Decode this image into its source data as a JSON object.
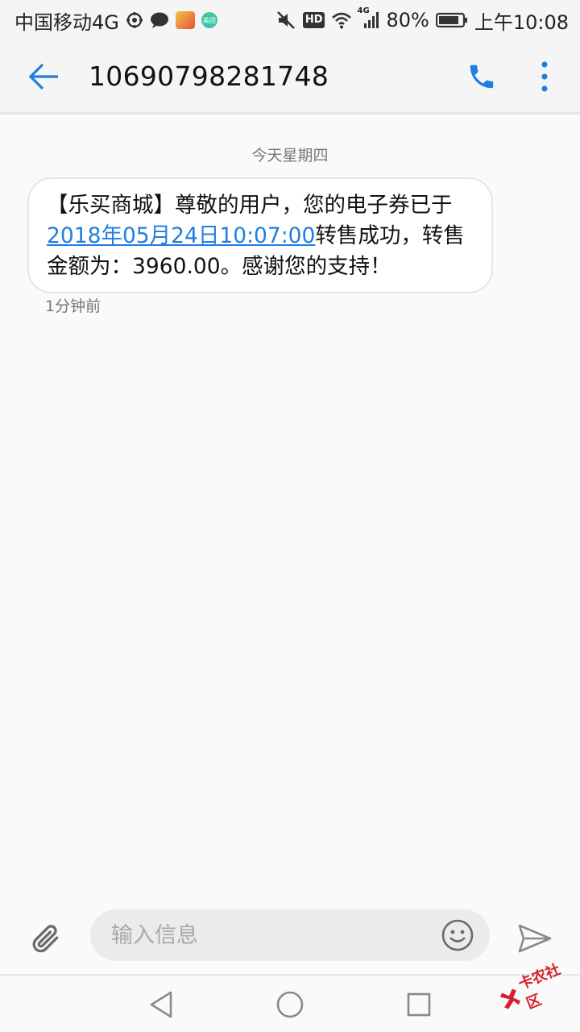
{
  "status_bar": {
    "carrier": "中国移动4G",
    "mini_green_label": "美团",
    "network_type": "4G",
    "battery_percent": "80%",
    "time": "上午10:08"
  },
  "header": {
    "title": "10690798281748"
  },
  "conversation": {
    "date_divider": "今天星期四",
    "messages": [
      {
        "text_before": "【乐买商城】尊敬的用户，您的电子券已于",
        "link_text": "2018年05月24日10:07:00",
        "text_after": "转售成功，转售金额为：3960.00。感谢您的支持！",
        "time": "1分钟前"
      }
    ]
  },
  "compose": {
    "placeholder": "输入信息"
  },
  "watermark": {
    "text": "卡农社区"
  },
  "colors": {
    "accent": "#1f7ee0",
    "watermark_red": "#d61f2c"
  }
}
